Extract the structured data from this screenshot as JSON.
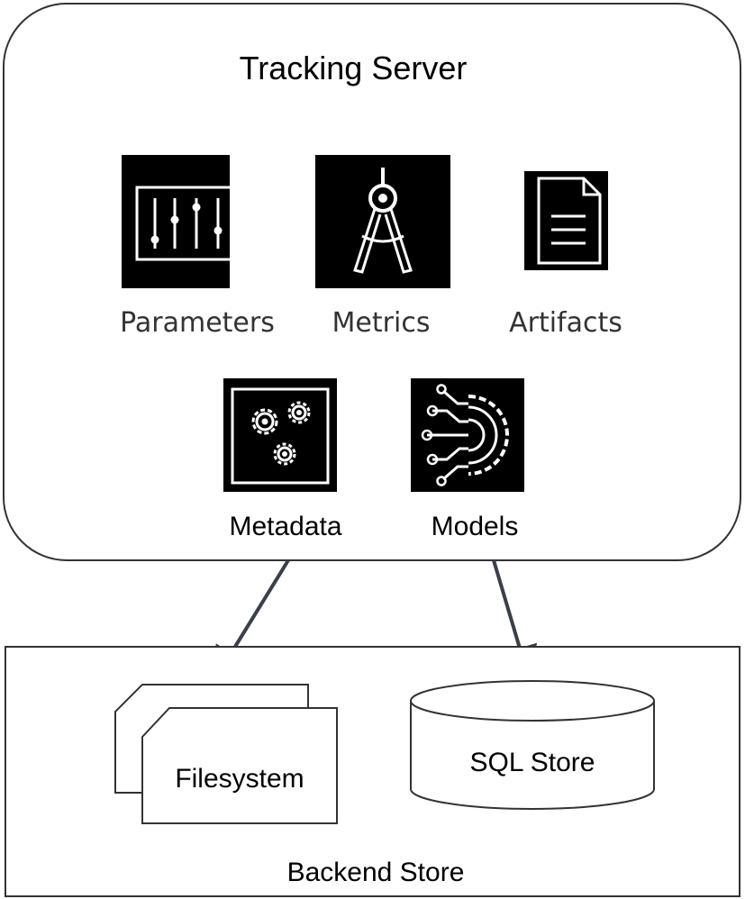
{
  "tracking_server": {
    "title": "Tracking Server",
    "items": {
      "parameters": "Parameters",
      "metrics": "Metrics",
      "artifacts": "Artifacts",
      "metadata": "Metadata",
      "models": "Models"
    }
  },
  "backend_store": {
    "title": "Backend Store",
    "filesystem": "Filesystem",
    "sql_store": "SQL Store"
  },
  "icons": {
    "parameters": "sliders-icon",
    "metrics": "compass-icon",
    "artifacts": "document-icon",
    "metadata": "gears-icon",
    "models": "circuit-gear-icon"
  },
  "colors": {
    "stroke": "#333333",
    "icon_bg": "#000000",
    "icon_fg": "#ffffff",
    "arrow": "#3a3f4a"
  }
}
